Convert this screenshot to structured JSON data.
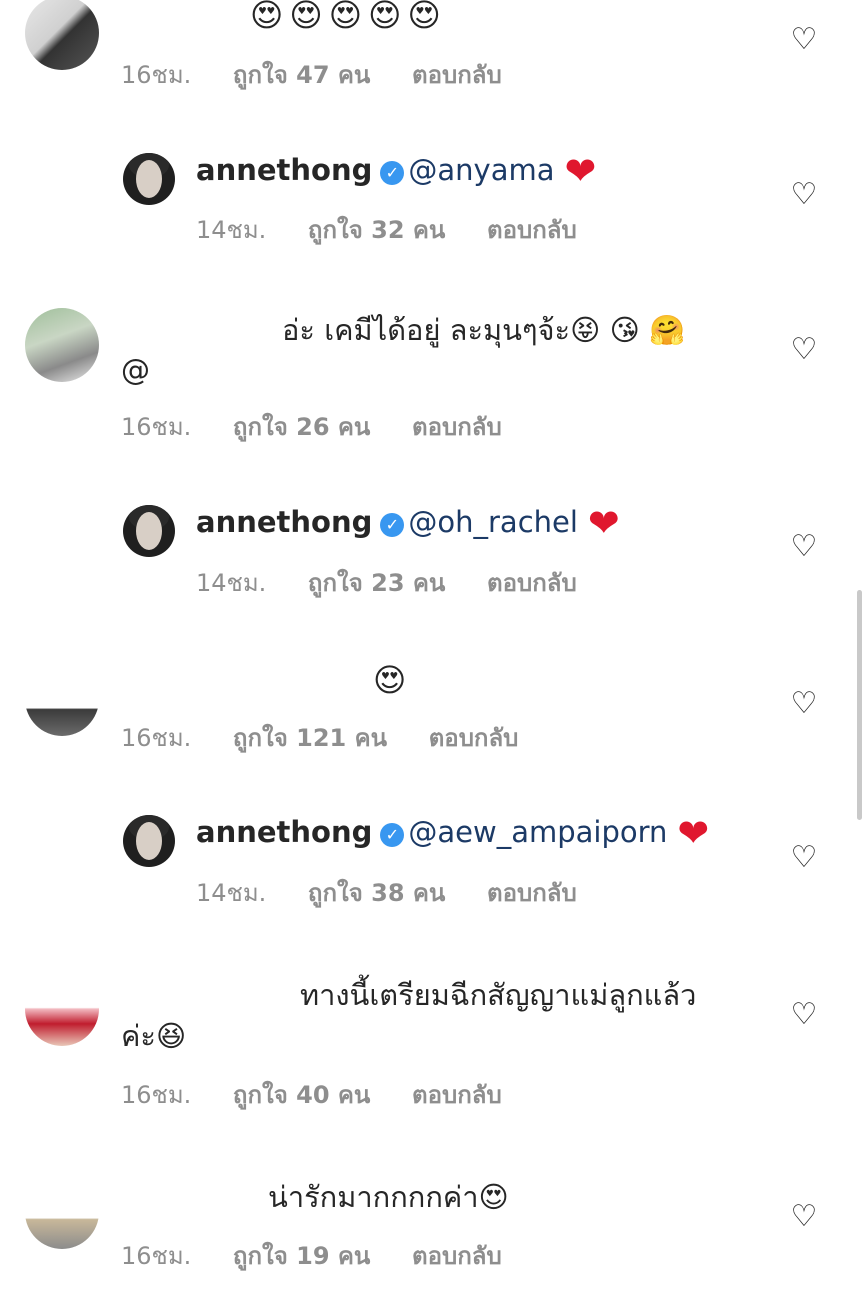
{
  "comments": [
    {
      "id": "c1",
      "type": "top",
      "text": "😍😍😍😍😍",
      "time": "16ชม.",
      "likes": "ถูกใจ 47 คน",
      "reply": "ตอบกลับ"
    },
    {
      "id": "r1",
      "type": "reply",
      "username": "annethong",
      "mention": "@anyama",
      "time": "14ชม.",
      "likes": "ถูกใจ 32 คน",
      "reply": "ตอบกลับ"
    },
    {
      "id": "c2",
      "type": "top",
      "text": "อ่ะ เคมีได้อยู่ ละมุนๆจ้ะ😝 😘 🤗",
      "text2": "@",
      "time": "16ชม.",
      "likes": "ถูกใจ 26 คน",
      "reply": "ตอบกลับ"
    },
    {
      "id": "r2",
      "type": "reply",
      "username": "annethong",
      "mention": "@oh_rachel",
      "time": "14ชม.",
      "likes": "ถูกใจ 23 คน",
      "reply": "ตอบกลับ"
    },
    {
      "id": "c3",
      "type": "top",
      "text": "😍",
      "time": "16ชม.",
      "likes": "ถูกใจ 121 คน",
      "reply": "ตอบกลับ"
    },
    {
      "id": "r3",
      "type": "reply",
      "username": "annethong",
      "mention": "@aew_ampaiporn",
      "time": "14ชม.",
      "likes": "ถูกใจ 38 คน",
      "reply": "ตอบกลับ"
    },
    {
      "id": "c4",
      "type": "top",
      "text": "ทางนี้เตรียมฉีกสัญญาแม่ลูกแล้ว",
      "text2": "ค่ะ😆",
      "time": "16ชม.",
      "likes": "ถูกใจ 40 คน",
      "reply": "ตอบกลับ"
    },
    {
      "id": "c5",
      "type": "top",
      "text": "น่ารักมากกกกค่า😍",
      "time": "16ชม.",
      "likes": "ถูกใจ 19 คน",
      "reply": "ตอบกลับ"
    }
  ],
  "icons": {
    "like": "heart-outline-icon",
    "verified": "verified-badge-icon",
    "heart_emoji": "❤️"
  },
  "colors": {
    "mention": "#1c3a66",
    "meta": "#8e8e8e",
    "verified": "#3897f0",
    "heart": "#e0172e"
  }
}
